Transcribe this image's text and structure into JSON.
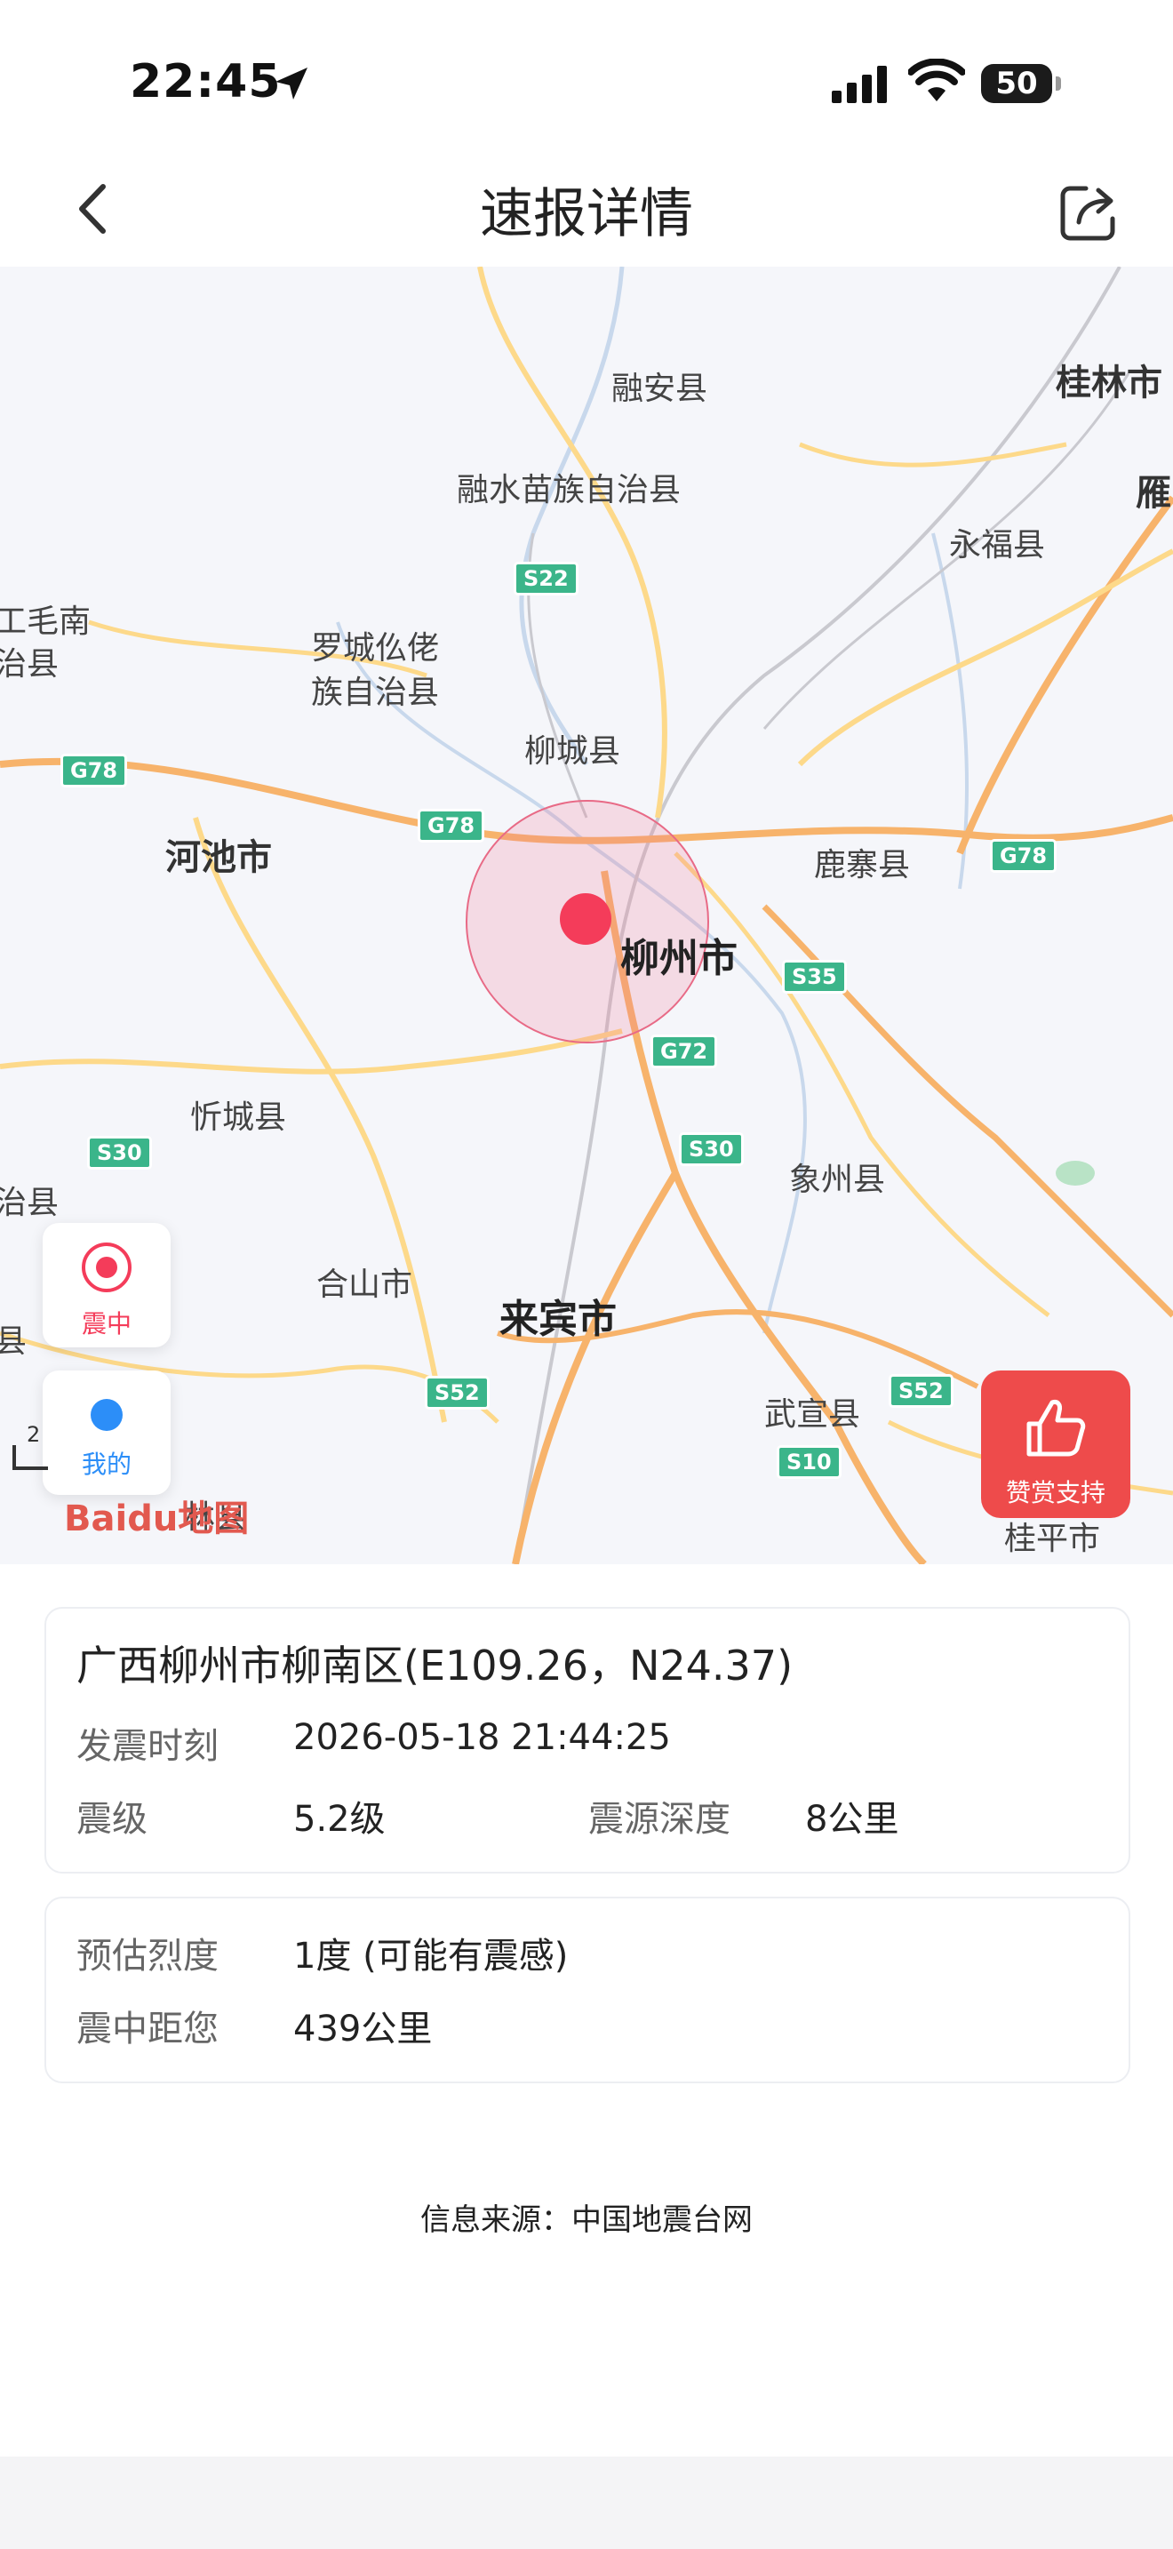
{
  "status_bar": {
    "time": "22:45",
    "battery": "50"
  },
  "nav": {
    "title": "速报详情"
  },
  "map": {
    "places": {
      "rongan": "融安县",
      "rongshui": "融水苗族自治县",
      "guilin": "桂林市",
      "yongfu": "永福县",
      "yan": "雁",
      "maonan_1": "工毛南",
      "maonan_2": "治县",
      "luocheng_1": "罗城仫佬",
      "luocheng_2": "族自治县",
      "liucheng": "柳城县",
      "hechi": "河池市",
      "luzhai": "鹿寨县",
      "liuzhou": "柳州市",
      "xincheng": "忻城县",
      "xiangzhou": "象州县",
      "heshan": "合山市",
      "laibin": "来宾市",
      "wuxuan": "武宣县",
      "guiping": "桂平市",
      "left_xian": "治县",
      "left_xian2": "县",
      "bottom_lin": "林县"
    },
    "shields": [
      "S22",
      "G78",
      "G78",
      "G78",
      "S35",
      "G72",
      "S30",
      "S30",
      "S52",
      "S52",
      "S10"
    ],
    "ctrl_epicenter_label": "震中",
    "ctrl_mine_label": "我的",
    "reward_label": "赞赏支持",
    "baidu_logo": "Baidu地图",
    "scale_num": "2"
  },
  "info": {
    "location": "广西柳州市柳南区(E109.26，N24.37)",
    "time_label": "发震时刻",
    "time_value": "2026-05-18 21:44:25",
    "magnitude_label": "震级",
    "magnitude_value": "5.2级",
    "depth_label": "震源深度",
    "depth_value": "8公里",
    "intensity_label": "预估烈度",
    "intensity_value": "1度 (可能有震感)",
    "distance_label": "震中距您",
    "distance_value": "439公里"
  },
  "source": "信息来源：中国地震台网",
  "colors": {
    "epicenter": "#f43c5a",
    "reward": "#ee4b4b",
    "highway": "#3bb58a"
  }
}
